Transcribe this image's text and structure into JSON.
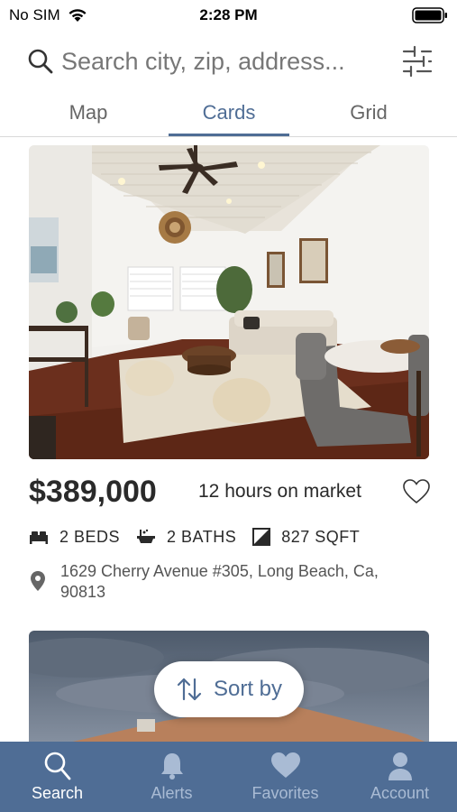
{
  "status_bar": {
    "carrier": "No SIM",
    "time": "2:28 PM"
  },
  "search": {
    "placeholder": "Search city, zip, address..."
  },
  "view_tabs": [
    {
      "label": "Map",
      "active": false
    },
    {
      "label": "Cards",
      "active": true
    },
    {
      "label": "Grid",
      "active": false
    }
  ],
  "listing": {
    "price": "$389,000",
    "time_on_market": "12 hours on market",
    "beds": "2 BEDS",
    "baths": "2 BATHS",
    "sqft": "827 SQFT",
    "address": "1629 Cherry Avenue #305, Long Beach, Ca, 90813"
  },
  "sort_button": {
    "label": "Sort by"
  },
  "bottom_tabs": [
    {
      "label": "Search",
      "icon": "search-icon",
      "active": true
    },
    {
      "label": "Alerts",
      "icon": "bell-icon",
      "active": false
    },
    {
      "label": "Favorites",
      "icon": "heart-icon",
      "active": false
    },
    {
      "label": "Account",
      "icon": "person-icon",
      "active": false
    }
  ],
  "colors": {
    "accent": "#4f6d95",
    "tab_bar_inactive": "#a9bbd4"
  }
}
